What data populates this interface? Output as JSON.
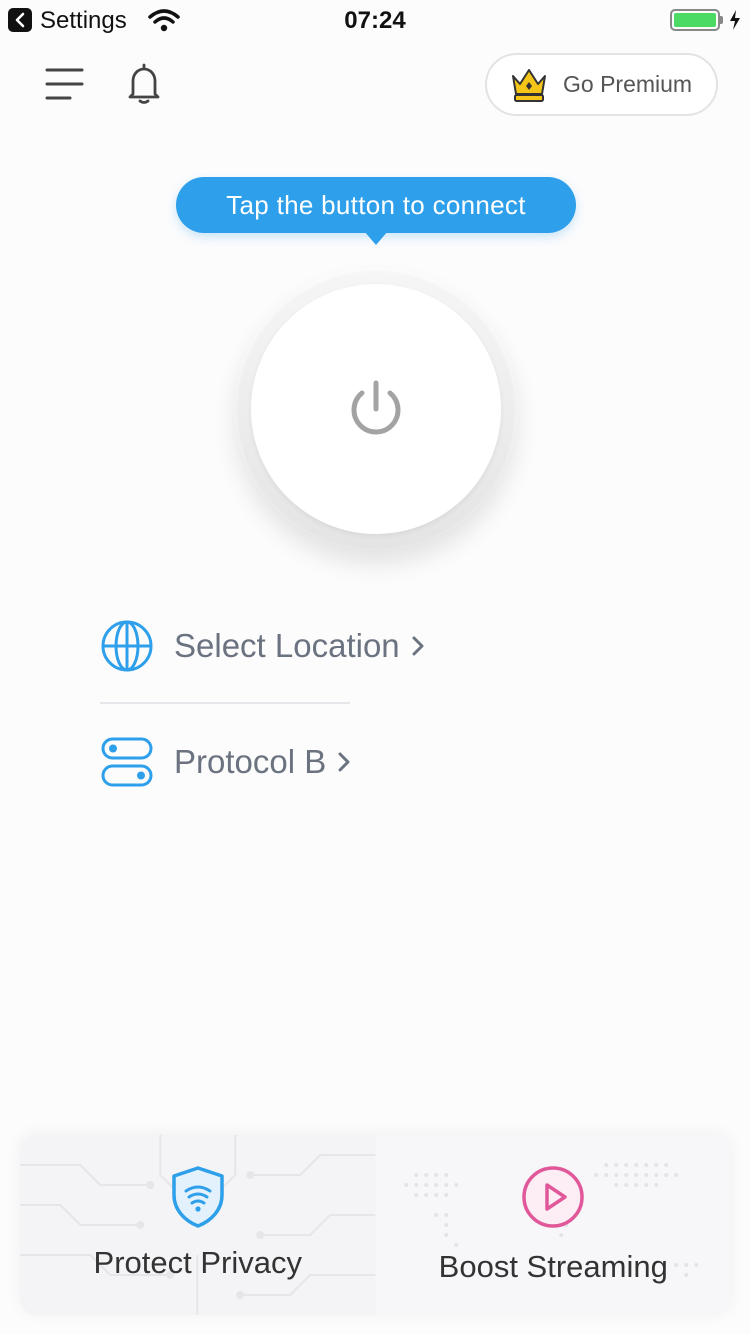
{
  "status_bar": {
    "back_label": "Settings",
    "time": "07:24",
    "battery_color": "#4cd964"
  },
  "header": {
    "menu_icon": "menu-icon",
    "notifications_icon": "bell-icon",
    "premium_label": "Go Premium",
    "premium_icon": "crown-icon"
  },
  "tooltip": {
    "text": "Tap the button to connect",
    "color": "#2e9fea"
  },
  "power_button": {
    "icon": "power-icon",
    "state": "disconnected"
  },
  "options": {
    "location_label": "Select Location",
    "location_icon": "globe-icon",
    "protocol_label": "Protocol B",
    "protocol_icon": "toggle-switches-icon",
    "icon_color": "#2e9fea"
  },
  "features": [
    {
      "label": "Protect Privacy",
      "icon": "shield-wifi-icon",
      "accent": "#2e9fea"
    },
    {
      "label": "Boost Streaming",
      "icon": "play-circle-icon",
      "accent": "#e0589a"
    }
  ]
}
